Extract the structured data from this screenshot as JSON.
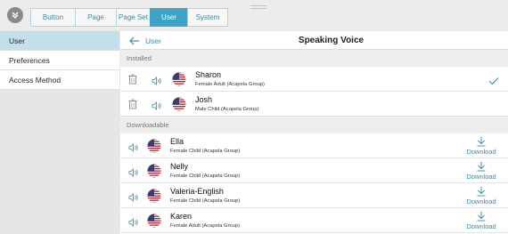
{
  "topbar": {
    "tabs": [
      {
        "label": "Button",
        "active": false
      },
      {
        "label": "Page",
        "active": false
      },
      {
        "label": "Page Set",
        "active": false
      },
      {
        "label": "User",
        "active": true
      },
      {
        "label": "System",
        "active": false
      }
    ]
  },
  "sidebar": {
    "items": [
      {
        "label": "User",
        "active": true
      },
      {
        "label": "Preferences",
        "active": false
      },
      {
        "label": "Access Method",
        "active": false
      }
    ]
  },
  "header": {
    "back_label": "User",
    "title": "Speaking Voice"
  },
  "installed": {
    "label": "Installed",
    "voices": [
      {
        "name": "Sharon",
        "desc": "Female Adult (Acapela Group)",
        "selected": true
      },
      {
        "name": "Josh",
        "desc": "Male Child (Acapela Group)",
        "selected": false
      }
    ]
  },
  "downloadable": {
    "label": "Downloadable",
    "download_label": "Download",
    "voices": [
      {
        "name": "Ella",
        "desc": "Female Child (Acapela Group)"
      },
      {
        "name": "Nelly",
        "desc": "Female Child (Acapela Group)"
      },
      {
        "name": "Valeria-English",
        "desc": "Female Child (Acapela Group)"
      },
      {
        "name": "Karen",
        "desc": "Female Adult (Acapela Group)"
      }
    ]
  },
  "colors": {
    "accent": "#3fa3c4",
    "link": "#3a8aa8",
    "sidebar_active": "#c2dfeb"
  },
  "icons": {
    "menu": "chevron-double-down-icon",
    "back": "arrow-left-icon",
    "delete": "trash-icon",
    "preview": "speaker-icon",
    "language": "us-flag-icon",
    "selected": "checkmark-icon",
    "download": "download-arrow-icon"
  }
}
